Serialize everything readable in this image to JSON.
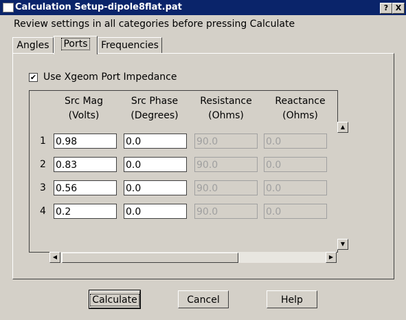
{
  "window": {
    "title": "Calculation Setup-dipole8flat.pat",
    "help_btn": "?",
    "close_btn": "X"
  },
  "intro_text": "Review settings in all categories before pressing Calculate",
  "tabs": [
    {
      "label": "Angles",
      "active": false
    },
    {
      "label": "Ports",
      "active": true
    },
    {
      "label": "Frequencies",
      "active": false
    }
  ],
  "ports": {
    "checkbox_label": "Use Xgeom Port Impedance",
    "checkbox_checked": true,
    "checkbox_mark": "✔",
    "headers": [
      {
        "line1": "Src Mag",
        "line2": "(Volts)"
      },
      {
        "line1": "Src Phase",
        "line2": "(Degrees)"
      },
      {
        "line1": "Resistance",
        "line2": "(Ohms)"
      },
      {
        "line1": "Reactance",
        "line2": "(Ohms)"
      }
    ],
    "rows": [
      {
        "num": "1",
        "mag": "0.98",
        "phase": "0.0",
        "res": "90.0",
        "react": "0.0"
      },
      {
        "num": "2",
        "mag": "0.83",
        "phase": "0.0",
        "res": "90.0",
        "react": "0.0"
      },
      {
        "num": "3",
        "mag": "0.56",
        "phase": "0.0",
        "res": "90.0",
        "react": "0.0"
      },
      {
        "num": "4",
        "mag": "0.2",
        "phase": "0.0",
        "res": "90.0",
        "react": "0.0"
      }
    ]
  },
  "scroll": {
    "up": "▲",
    "down": "▼",
    "left": "◀",
    "right": "▶"
  },
  "buttons": {
    "calculate": "Calculate",
    "cancel": "Cancel",
    "help": "Help"
  }
}
